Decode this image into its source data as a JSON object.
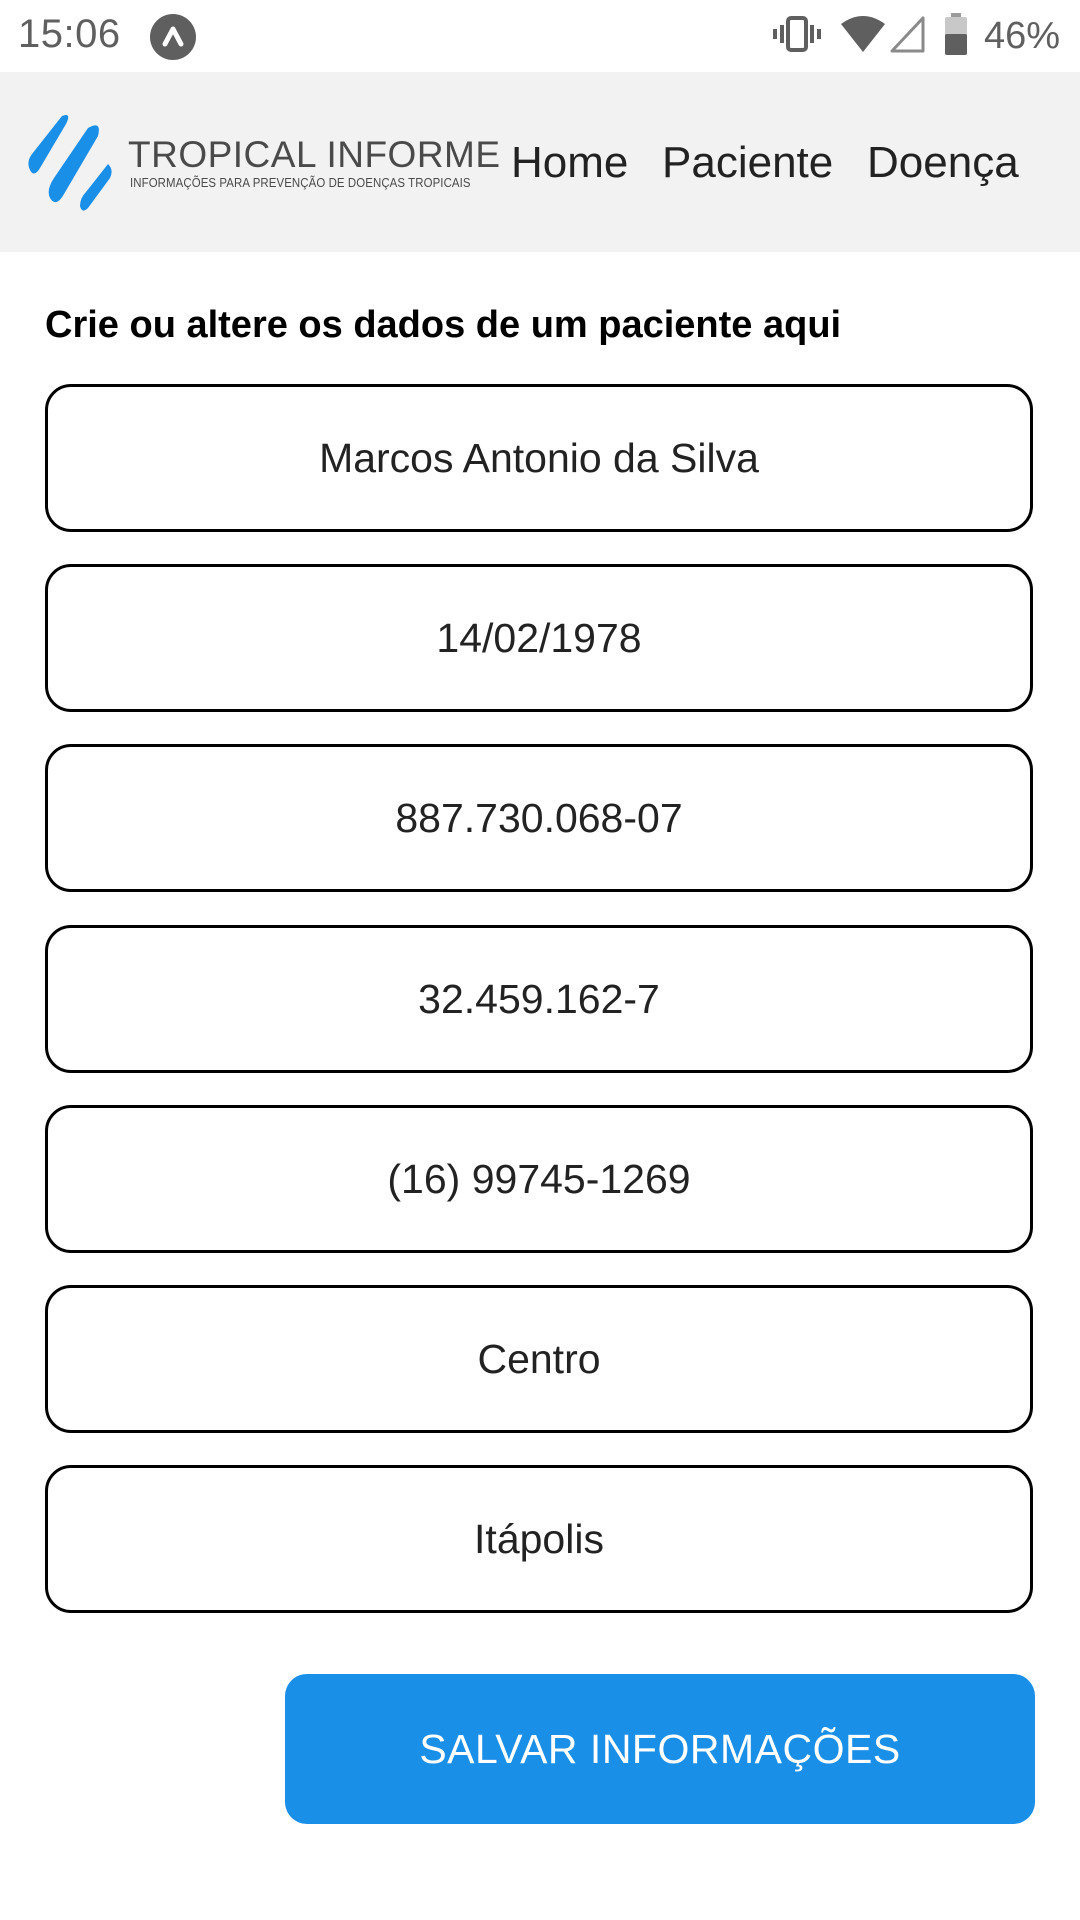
{
  "status_bar": {
    "time": "15:06",
    "battery_percent": "46%",
    "icons": [
      "app-notification-icon",
      "vibrate-icon",
      "wifi-icon",
      "cell-signal-icon",
      "battery-icon"
    ]
  },
  "header": {
    "logo_title": "TROPICAL INFORME",
    "logo_subtitle": "INFORMAÇÕES PARA PREVENÇÃO DE DOENÇAS TROPICAIS",
    "nav": {
      "home": "Home",
      "paciente": "Paciente",
      "doenca": "Doença"
    },
    "brand_color": "#1a8fe8",
    "background_color": "#f2f2f2"
  },
  "form": {
    "heading": "Crie ou altere os dados de um paciente aqui",
    "fields": {
      "nome": "Marcos Antonio da Silva",
      "nascimento": "14/02/1978",
      "cpf": "887.730.068-07",
      "rg": "32.459.162-7",
      "telefone": "(16) 99745-1269",
      "bairro": "Centro",
      "cidade": "Itápolis"
    },
    "save_label": "SALVAR INFORMAÇÕES"
  }
}
